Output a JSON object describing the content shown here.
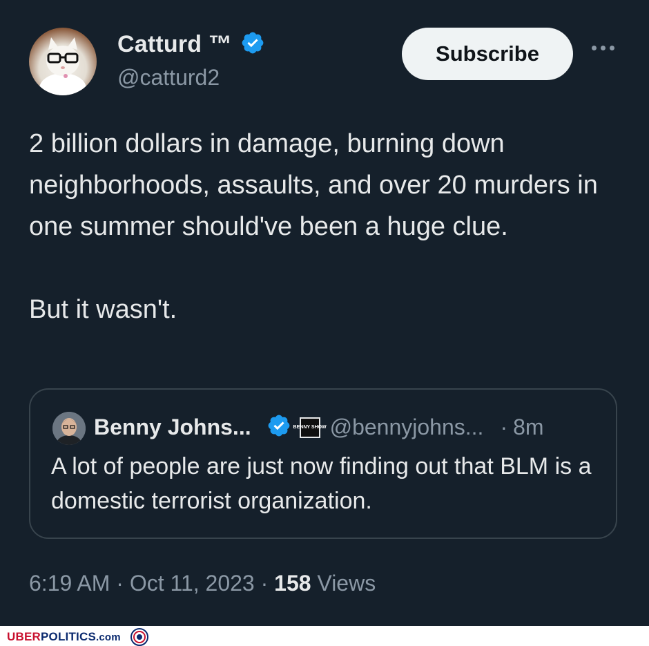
{
  "tweet": {
    "author_name": "Catturd ™",
    "author_handle": "@catturd2",
    "subscribe_label": "Subscribe",
    "text": "2 billion dollars in damage, burning down neighborhoods, assaults, and over 20 murders in one summer should've been a huge clue.\n\nBut it wasn't.",
    "timestamp": "6:19 AM · Oct 11, 2023 · ",
    "views_count": "158",
    "views_label": " Views"
  },
  "quote": {
    "author_name": "Benny Johns...",
    "affiliate_badge_text": "BENNY SHOW",
    "author_handle": "@bennyjohns...",
    "separator": "·",
    "time": "8m",
    "text": "A lot of people are just now finding out that BLM is a domestic terrorist organization."
  },
  "watermark": {
    "uber": "UBER",
    "politics": "POLITICS",
    "com": ".com"
  },
  "icons": {
    "verified": "verified-badge-icon",
    "more": "more-options-icon"
  },
  "colors": {
    "background": "#15202b",
    "text": "#e7e9ea",
    "secondary_text": "#8b98a5",
    "verified": "#1d9bf0",
    "border": "#38444d",
    "subscribe_bg": "#eff3f4"
  }
}
